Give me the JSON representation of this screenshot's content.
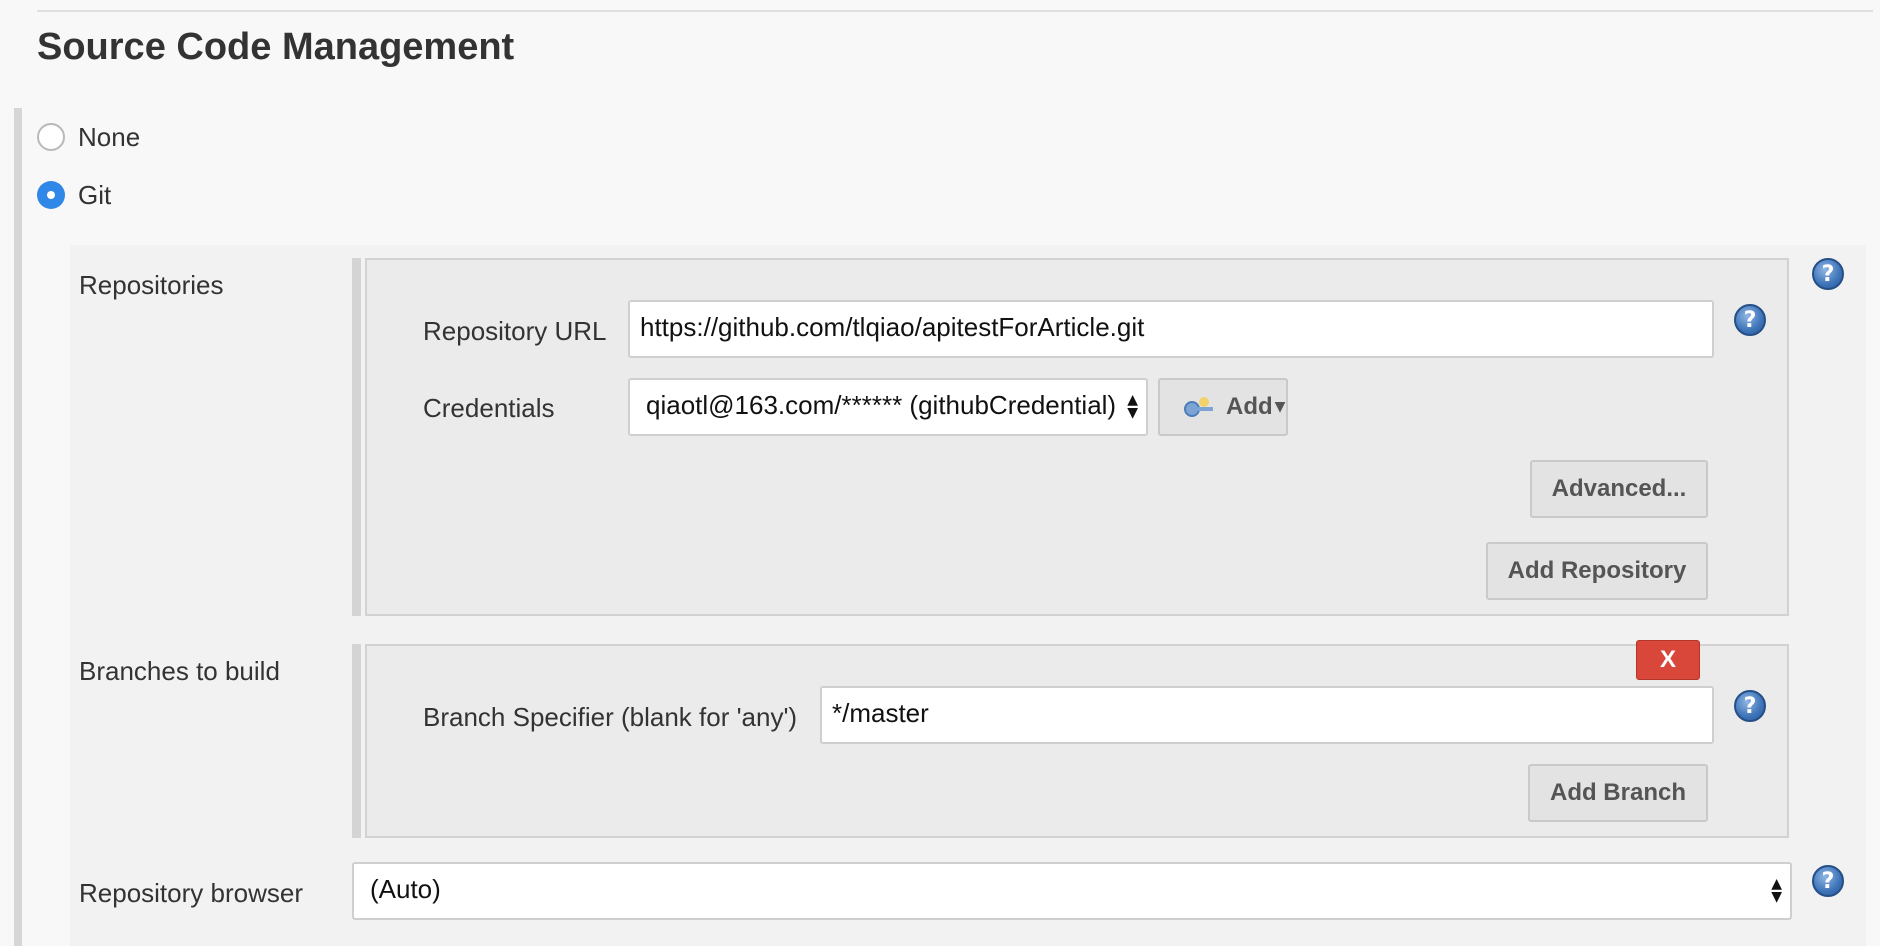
{
  "section": {
    "title": "Source Code Management"
  },
  "scm_options": [
    {
      "label": "None",
      "selected": false
    },
    {
      "label": "Git",
      "selected": true
    }
  ],
  "repositories": {
    "label": "Repositories",
    "url_label": "Repository URL",
    "url_value": "https://github.com/tlqiao/apitestForArticle.git",
    "credentials_label": "Credentials",
    "credentials_value": "qiaotl@163.com/****** (githubCredential)",
    "add_label": "Add",
    "advanced_label": "Advanced...",
    "add_repository_label": "Add Repository"
  },
  "branches": {
    "label": "Branches to build",
    "delete_label": "X",
    "specifier_label": "Branch Specifier (blank for 'any')",
    "specifier_value": "*/master",
    "add_branch_label": "Add Branch"
  },
  "browser": {
    "label": "Repository browser",
    "value": "(Auto)"
  },
  "help_glyph": "?",
  "select_arrows": "▲▼",
  "icons": [
    "help-icon",
    "key-icon",
    "dropdown-arrow-icon",
    "radio-icon"
  ],
  "colors": {
    "accent": "#2f87e8",
    "delete": "#d9473b",
    "help": "#3d73b8"
  }
}
